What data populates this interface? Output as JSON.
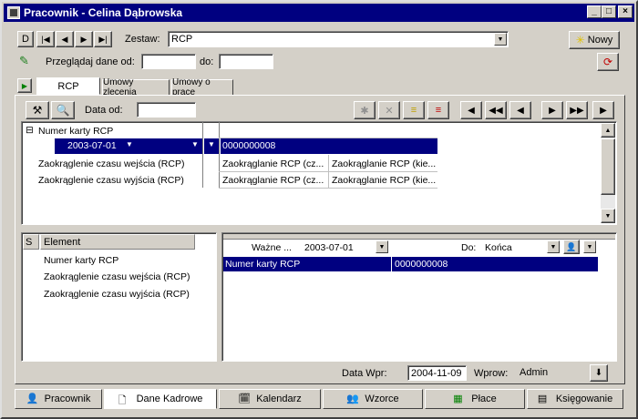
{
  "window": {
    "title": "Pracownik - Celina Dąbrowska"
  },
  "nav": {
    "first": "D",
    "prev_first": "|◀",
    "prev": "◀",
    "next": "▶",
    "last": "▶|"
  },
  "zestaw": {
    "label": "Zestaw:",
    "value": "RCP"
  },
  "nowy_button": "Nowy",
  "przegladaj": {
    "label": "Przeglądaj dane od:",
    "od_value": "",
    "do_label": "do:",
    "do_value": ""
  },
  "tabs": [
    {
      "label": "RCP",
      "active": true
    },
    {
      "label": "Umowy zlecenia",
      "active": false
    },
    {
      "label": "Umowy o pracę",
      "active": false
    }
  ],
  "toolbar": {
    "data_od_label": "Data od:",
    "data_od_value": ""
  },
  "top_grid": {
    "root_label": "Numer karty RCP",
    "sel_date": "2003-07-01",
    "sel_value": "0000000008",
    "rows": [
      {
        "label": "Zaokrąglenie czasu wejścia (RCP)",
        "v1": "Zaokrąglanie RCP (cz...",
        "v2": "Zaokrąglanie RCP (kie..."
      },
      {
        "label": "Zaokrąglenie czasu wyjścia (RCP)",
        "v1": "Zaokrąglanie RCP (cz...",
        "v2": "Zaokrąglanie RCP (kie..."
      }
    ]
  },
  "left_list": {
    "col_s": "S",
    "col_element": "Element",
    "items": [
      "Numer karty RCP",
      "Zaokrąglenie czasu wejścia (RCP)",
      "Zaokrąglenie czasu wyjścia (RCP)"
    ]
  },
  "right_panel": {
    "wazne_label": "Ważne ...",
    "wazne_value": "2003-07-01",
    "do_label": "Do:",
    "do_value": "Końca",
    "row_label": "Numer karty RCP",
    "row_value": "0000000008"
  },
  "footer": {
    "data_wpr_label": "Data Wpr:",
    "data_wpr_value": "2004-11-09",
    "wprow_label": "Wprow:",
    "wprow_value": "Admin"
  },
  "bottom_tabs": [
    "Pracownik",
    "Dane Kadrowe",
    "Kalendarz",
    "Wzorce",
    "Płace",
    "Księgowanie"
  ]
}
